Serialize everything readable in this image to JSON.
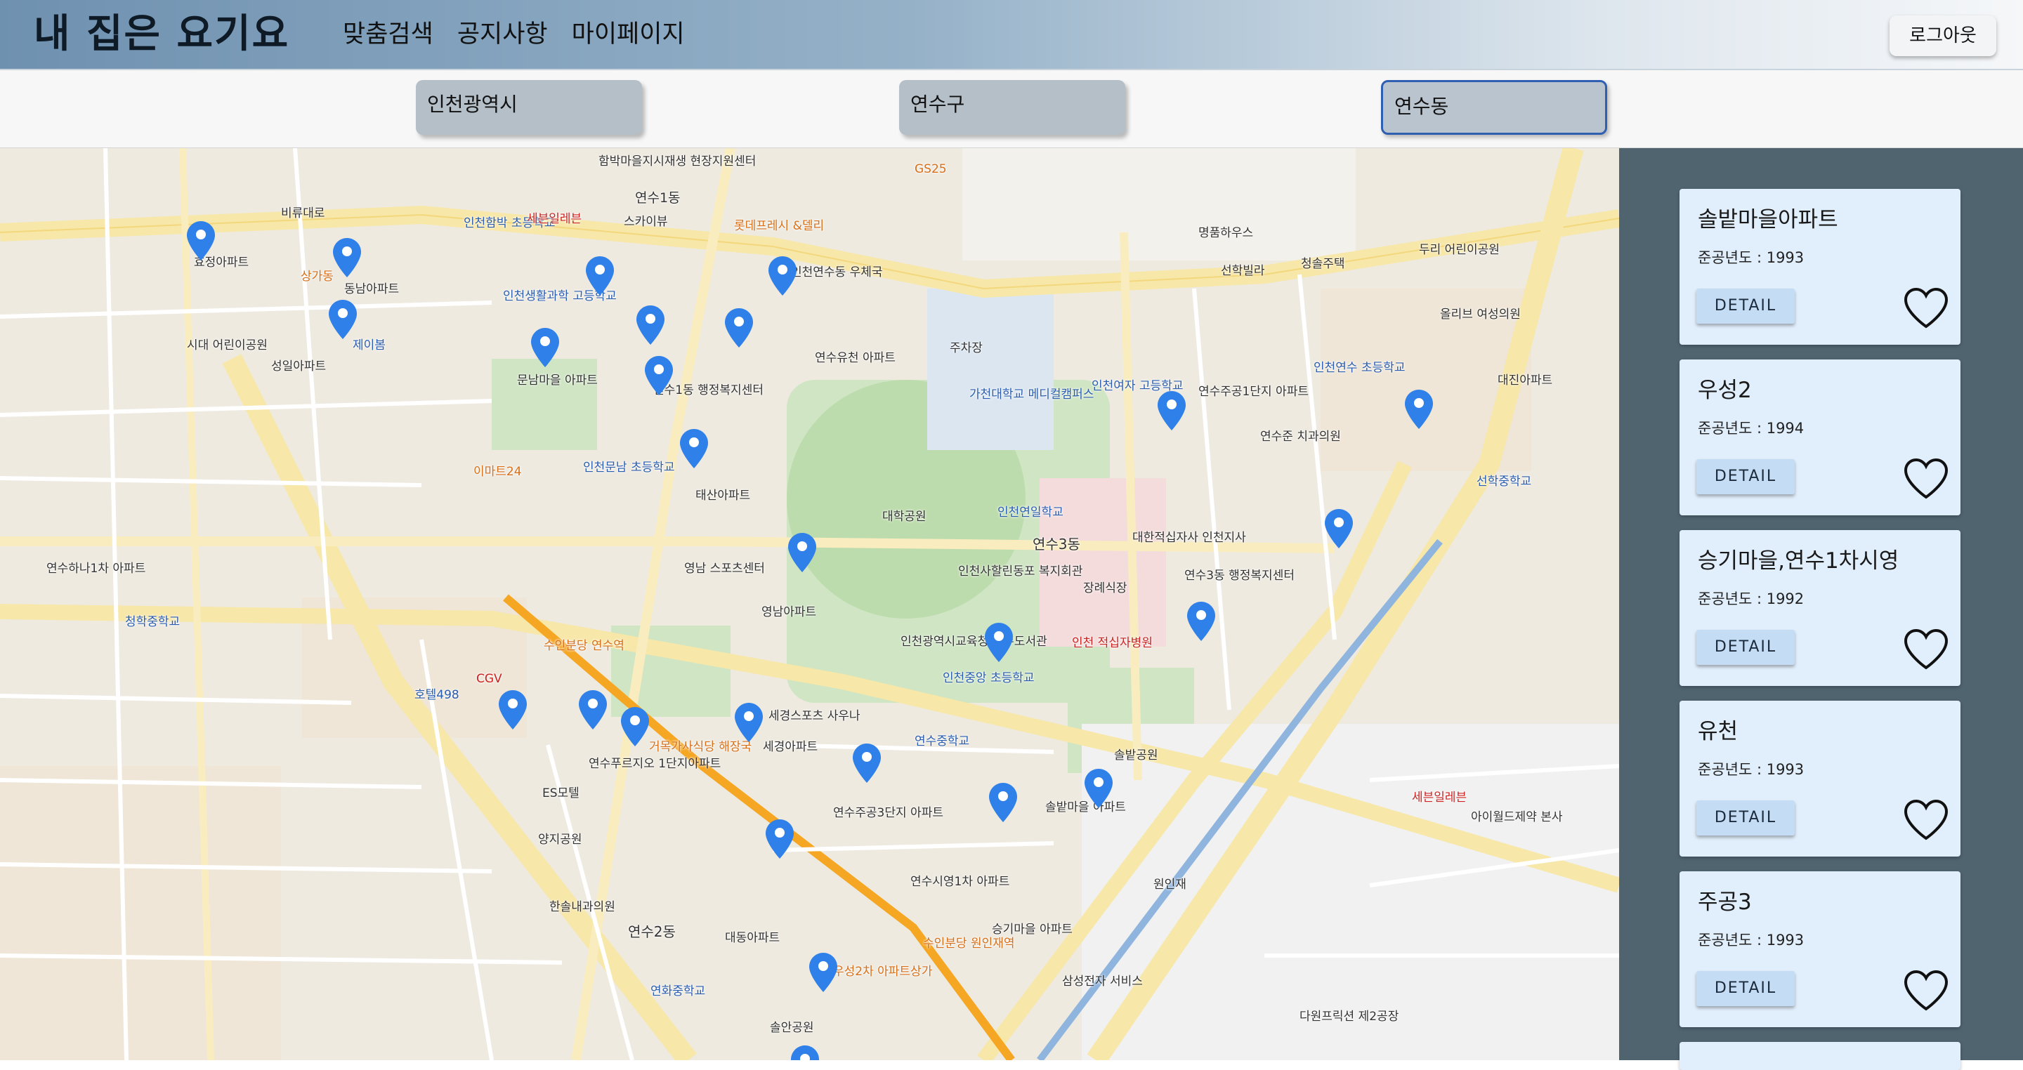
{
  "header": {
    "brand": "내 집은 요기요",
    "nav": [
      "맞춤검색",
      "공지사항",
      "마이페이지"
    ],
    "logout_label": "로그아웃"
  },
  "filters": {
    "city": "인천광역시",
    "district": "연수구",
    "dong": "연수동"
  },
  "map": {
    "labels": [
      "함박마을지시재생 현장지원센터",
      "연수1동",
      "스카이뷰",
      "롯데프레시 &델리",
      "GS25",
      "인천함박 초등학교",
      "세븐일레븐",
      "비류대로",
      "명품하우스",
      "선학빌라",
      "청솔주택",
      "인천생활과학 고등학교",
      "효정아파트",
      "동남아파트",
      "상가동",
      "제이봄",
      "시대 어린이공원",
      "성일아파트",
      "문남마을 아파트",
      "연수1동 행정복지센터",
      "인천연수동 우체국",
      "연수유천 아파트",
      "주차장",
      "가천대학교 메디컬캠퍼스",
      "인천여자 고등학교",
      "연수주공1단지 아파트",
      "연수준 치과의원",
      "인천연수 초등학교",
      "대학공원",
      "인천연일학교",
      "연수3동",
      "대한적십자사 인천지사",
      "연수3동 행정복지센터",
      "장례식장",
      "인천 적십자병원",
      "인천사할린동포 복지회관",
      "인천광역시교육청 연수도서관",
      "인천중앙 초등학교",
      "연수중학교",
      "솔밭공원",
      "수인분당 원인재역",
      "수인분당 연수역",
      "연수푸르지오 1단지아파트",
      "거목가사식당 해장국",
      "ES모텔",
      "양지공원",
      "세경스포츠 사우나",
      "세경아파트",
      "연수주공3단지 아파트",
      "솔밭마을 아파트",
      "연수시영1차 아파트",
      "승기마을 아파트",
      "우성2차 아파트상가",
      "연수2동",
      "대동아파트",
      "연화중학교",
      "솔안공원",
      "원인재",
      "세븐일레븐",
      "아이월드제약 본사",
      "선학중학교",
      "두리 어린이공원",
      "올리브 여성의원",
      "대진아파트",
      "연수하나1차 아파트",
      "청학중학교",
      "CGV",
      "호텔498",
      "이마트24",
      "인천문남 초등학교",
      "태산아파트",
      "영남아파트",
      "영남 스포츠센터",
      "한솔내과의원",
      "삼성전자 서비스",
      "다원프릭션 제2공장"
    ]
  },
  "listings": [
    {
      "name": "솔밭마을아파트",
      "year": "준공년도 : 1993",
      "detail": "DETAIL"
    },
    {
      "name": "우성2",
      "year": "준공년도 : 1994",
      "detail": "DETAIL"
    },
    {
      "name": "승기마을,연수1차시영",
      "year": "준공년도 : 1992",
      "detail": "DETAIL"
    },
    {
      "name": "유천",
      "year": "준공년도 : 1993",
      "detail": "DETAIL"
    },
    {
      "name": "주공3",
      "year": "준공년도 : 1993",
      "detail": "DETAIL"
    }
  ],
  "colors": {
    "header_start": "#6f91b0",
    "panel_bg": "#506470",
    "card_bg": "#e1eefb",
    "marker": "#2f80e8",
    "select_bg": "#b4bfc8"
  },
  "icons": {
    "marker": "map-pin-icon",
    "favorite": "heart-outline-icon"
  }
}
